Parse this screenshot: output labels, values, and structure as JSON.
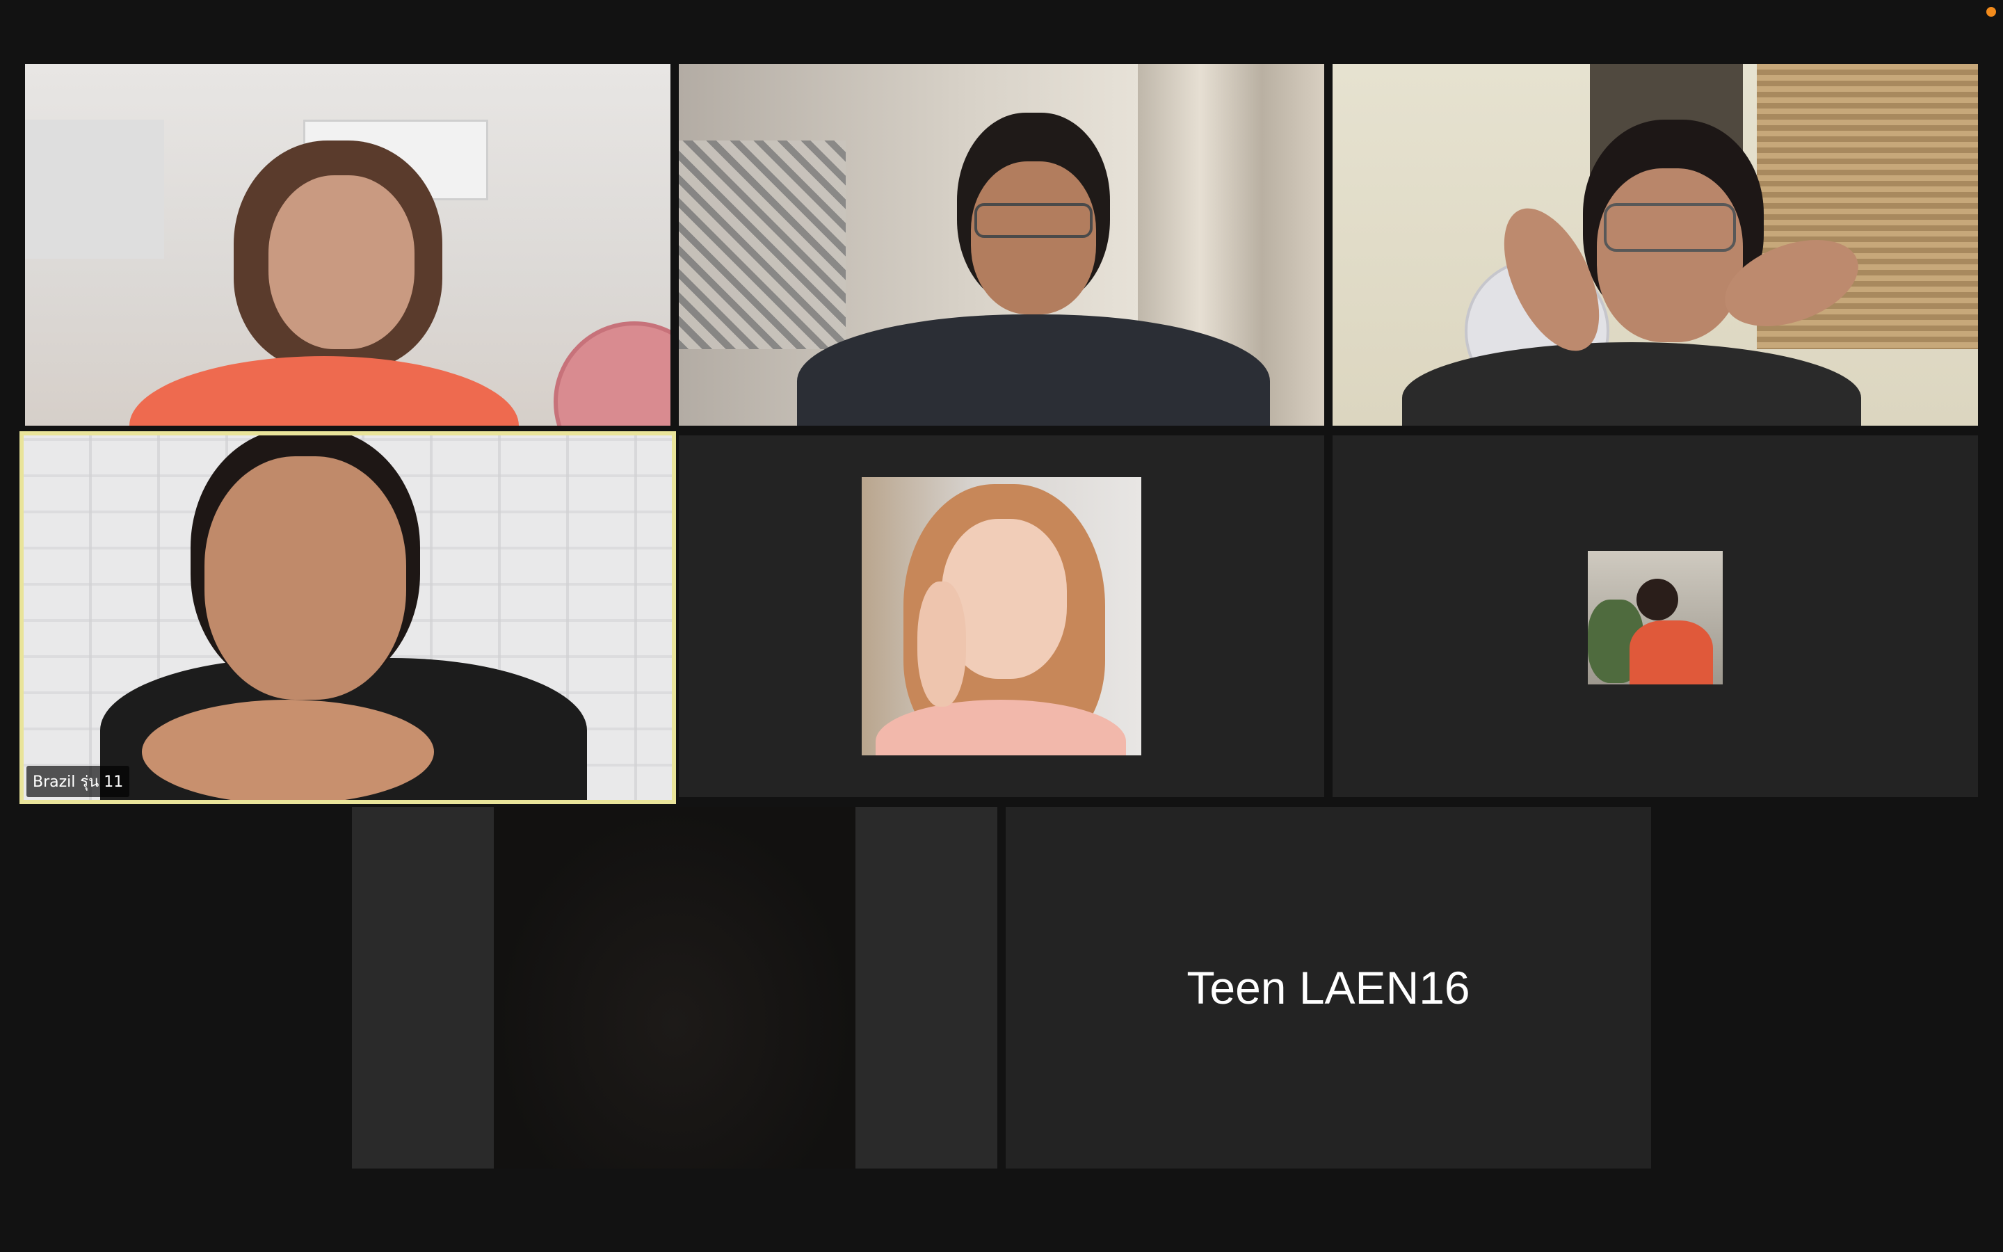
{
  "app": {
    "recording_indicator_color": "#f28b1c",
    "active_speaker_border_color": "#e9e49a"
  },
  "participants": [
    {
      "id": "p1",
      "type": "video",
      "label": ""
    },
    {
      "id": "p2",
      "type": "video",
      "label": ""
    },
    {
      "id": "p3",
      "type": "video",
      "label": ""
    },
    {
      "id": "p4",
      "type": "video",
      "label": "Brazil รุ่น 11",
      "active_speaker": true
    },
    {
      "id": "p5",
      "type": "profile_photo",
      "label": ""
    },
    {
      "id": "p6",
      "type": "profile_photo",
      "label": ""
    },
    {
      "id": "p7",
      "type": "video_dark",
      "label": ""
    },
    {
      "id": "p8",
      "type": "name_only",
      "label": "Teen LAEN16"
    }
  ]
}
